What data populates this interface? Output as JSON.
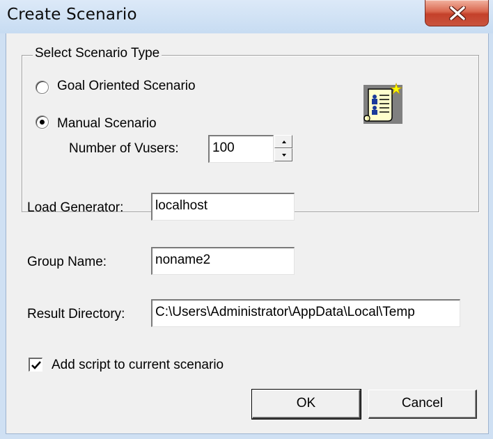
{
  "window": {
    "title": "Create Scenario"
  },
  "scenario_type": {
    "legend": "Select Scenario Type",
    "options": [
      {
        "label": "Goal Oriented Scenario",
        "selected": false
      },
      {
        "label": "Manual Scenario",
        "selected": true
      }
    ],
    "vusers_label": "Number of Vusers:",
    "vusers_value": "100"
  },
  "form": {
    "load_generator_label": "Load Generator:",
    "load_generator_value": "localhost",
    "group_name_label": "Group Name:",
    "group_name_value": "noname2",
    "result_directory_label": "Result Directory:",
    "result_directory_value": "C:\\Users\\Administrator\\AppData\\Local\\Temp"
  },
  "add_script": {
    "label": "Add script to current scenario",
    "checked": true
  },
  "buttons": {
    "ok": "OK",
    "cancel": "Cancel"
  },
  "icons": {
    "close": "close-icon",
    "scenario": "scenario-scroll-icon",
    "spin_up": "spin-up-icon",
    "spin_down": "spin-down-icon",
    "check": "check-icon"
  },
  "colors": {
    "title_bar": "#c7dcf2",
    "dialog_face": "#f0f0f0",
    "close_button": "#c4402a"
  }
}
